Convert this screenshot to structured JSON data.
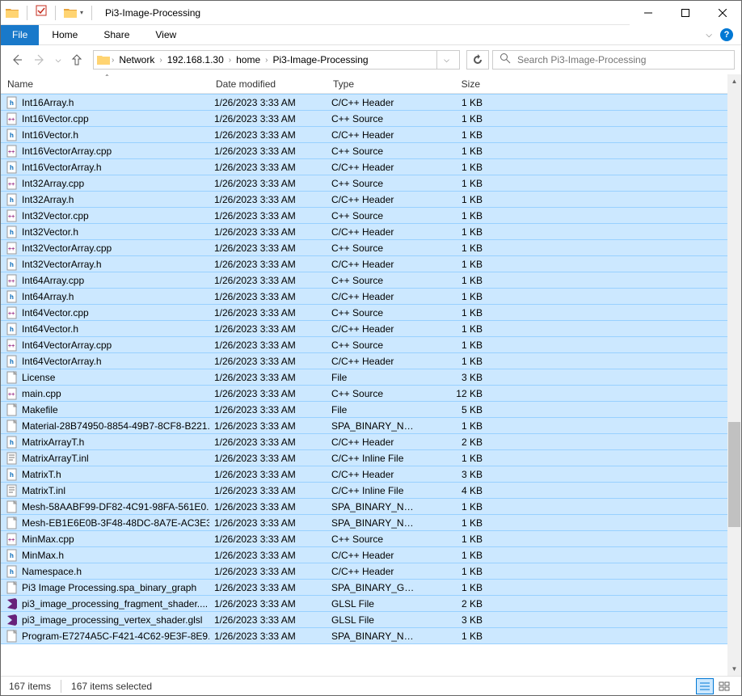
{
  "window": {
    "title": "Pi3-Image-Processing"
  },
  "ribbon": {
    "file": "File",
    "home": "Home",
    "share": "Share",
    "view": "View"
  },
  "breadcrumb": {
    "segments": [
      "Network",
      "192.168.1.30",
      "home",
      "Pi3-Image-Processing"
    ]
  },
  "search": {
    "placeholder": "Search Pi3-Image-Processing"
  },
  "columns": {
    "name": "Name",
    "date": "Date modified",
    "type": "Type",
    "size": "Size"
  },
  "status": {
    "items": "167 items",
    "selected": "167 items selected"
  },
  "files": [
    {
      "name": "Int16Array.h",
      "date": "1/26/2023 3:33 AM",
      "type": "C/C++ Header",
      "size": "1 KB",
      "icon": "h"
    },
    {
      "name": "Int16Vector.cpp",
      "date": "1/26/2023 3:33 AM",
      "type": "C++ Source",
      "size": "1 KB",
      "icon": "cpp"
    },
    {
      "name": "Int16Vector.h",
      "date": "1/26/2023 3:33 AM",
      "type": "C/C++ Header",
      "size": "1 KB",
      "icon": "h"
    },
    {
      "name": "Int16VectorArray.cpp",
      "date": "1/26/2023 3:33 AM",
      "type": "C++ Source",
      "size": "1 KB",
      "icon": "cpp"
    },
    {
      "name": "Int16VectorArray.h",
      "date": "1/26/2023 3:33 AM",
      "type": "C/C++ Header",
      "size": "1 KB",
      "icon": "h"
    },
    {
      "name": "Int32Array.cpp",
      "date": "1/26/2023 3:33 AM",
      "type": "C++ Source",
      "size": "1 KB",
      "icon": "cpp"
    },
    {
      "name": "Int32Array.h",
      "date": "1/26/2023 3:33 AM",
      "type": "C/C++ Header",
      "size": "1 KB",
      "icon": "h"
    },
    {
      "name": "Int32Vector.cpp",
      "date": "1/26/2023 3:33 AM",
      "type": "C++ Source",
      "size": "1 KB",
      "icon": "cpp"
    },
    {
      "name": "Int32Vector.h",
      "date": "1/26/2023 3:33 AM",
      "type": "C/C++ Header",
      "size": "1 KB",
      "icon": "h"
    },
    {
      "name": "Int32VectorArray.cpp",
      "date": "1/26/2023 3:33 AM",
      "type": "C++ Source",
      "size": "1 KB",
      "icon": "cpp"
    },
    {
      "name": "Int32VectorArray.h",
      "date": "1/26/2023 3:33 AM",
      "type": "C/C++ Header",
      "size": "1 KB",
      "icon": "h"
    },
    {
      "name": "Int64Array.cpp",
      "date": "1/26/2023 3:33 AM",
      "type": "C++ Source",
      "size": "1 KB",
      "icon": "cpp"
    },
    {
      "name": "Int64Array.h",
      "date": "1/26/2023 3:33 AM",
      "type": "C/C++ Header",
      "size": "1 KB",
      "icon": "h"
    },
    {
      "name": "Int64Vector.cpp",
      "date": "1/26/2023 3:33 AM",
      "type": "C++ Source",
      "size": "1 KB",
      "icon": "cpp"
    },
    {
      "name": "Int64Vector.h",
      "date": "1/26/2023 3:33 AM",
      "type": "C/C++ Header",
      "size": "1 KB",
      "icon": "h"
    },
    {
      "name": "Int64VectorArray.cpp",
      "date": "1/26/2023 3:33 AM",
      "type": "C++ Source",
      "size": "1 KB",
      "icon": "cpp"
    },
    {
      "name": "Int64VectorArray.h",
      "date": "1/26/2023 3:33 AM",
      "type": "C/C++ Header",
      "size": "1 KB",
      "icon": "h"
    },
    {
      "name": "License",
      "date": "1/26/2023 3:33 AM",
      "type": "File",
      "size": "3 KB",
      "icon": "file"
    },
    {
      "name": "main.cpp",
      "date": "1/26/2023 3:33 AM",
      "type": "C++ Source",
      "size": "12 KB",
      "icon": "cpp"
    },
    {
      "name": "Makefile",
      "date": "1/26/2023 3:33 AM",
      "type": "File",
      "size": "5 KB",
      "icon": "file"
    },
    {
      "name": "Material-28B74950-8854-49B7-8CF8-B221...",
      "date": "1/26/2023 3:33 AM",
      "type": "SPA_BINARY_NOD...",
      "size": "1 KB",
      "icon": "file"
    },
    {
      "name": "MatrixArrayT.h",
      "date": "1/26/2023 3:33 AM",
      "type": "C/C++ Header",
      "size": "2 KB",
      "icon": "h"
    },
    {
      "name": "MatrixArrayT.inl",
      "date": "1/26/2023 3:33 AM",
      "type": "C/C++ Inline File",
      "size": "1 KB",
      "icon": "txt"
    },
    {
      "name": "MatrixT.h",
      "date": "1/26/2023 3:33 AM",
      "type": "C/C++ Header",
      "size": "3 KB",
      "icon": "h"
    },
    {
      "name": "MatrixT.inl",
      "date": "1/26/2023 3:33 AM",
      "type": "C/C++ Inline File",
      "size": "4 KB",
      "icon": "txt"
    },
    {
      "name": "Mesh-58AABF99-DF82-4C91-98FA-561E0...",
      "date": "1/26/2023 3:33 AM",
      "type": "SPA_BINARY_NOD...",
      "size": "1 KB",
      "icon": "file"
    },
    {
      "name": "Mesh-EB1E6E0B-3F48-48DC-8A7E-AC3E3...",
      "date": "1/26/2023 3:33 AM",
      "type": "SPA_BINARY_NOD...",
      "size": "1 KB",
      "icon": "file"
    },
    {
      "name": "MinMax.cpp",
      "date": "1/26/2023 3:33 AM",
      "type": "C++ Source",
      "size": "1 KB",
      "icon": "cpp"
    },
    {
      "name": "MinMax.h",
      "date": "1/26/2023 3:33 AM",
      "type": "C/C++ Header",
      "size": "1 KB",
      "icon": "h"
    },
    {
      "name": "Namespace.h",
      "date": "1/26/2023 3:33 AM",
      "type": "C/C++ Header",
      "size": "1 KB",
      "icon": "h"
    },
    {
      "name": "Pi3 Image Processing.spa_binary_graph",
      "date": "1/26/2023 3:33 AM",
      "type": "SPA_BINARY_GRA...",
      "size": "1 KB",
      "icon": "file"
    },
    {
      "name": "pi3_image_processing_fragment_shader....",
      "date": "1/26/2023 3:33 AM",
      "type": "GLSL File",
      "size": "2 KB",
      "icon": "vs"
    },
    {
      "name": "pi3_image_processing_vertex_shader.glsl",
      "date": "1/26/2023 3:33 AM",
      "type": "GLSL File",
      "size": "3 KB",
      "icon": "vs"
    },
    {
      "name": "Program-E7274A5C-F421-4C62-9E3F-8E9...",
      "date": "1/26/2023 3:33 AM",
      "type": "SPA_BINARY_NOD...",
      "size": "1 KB",
      "icon": "file"
    }
  ]
}
